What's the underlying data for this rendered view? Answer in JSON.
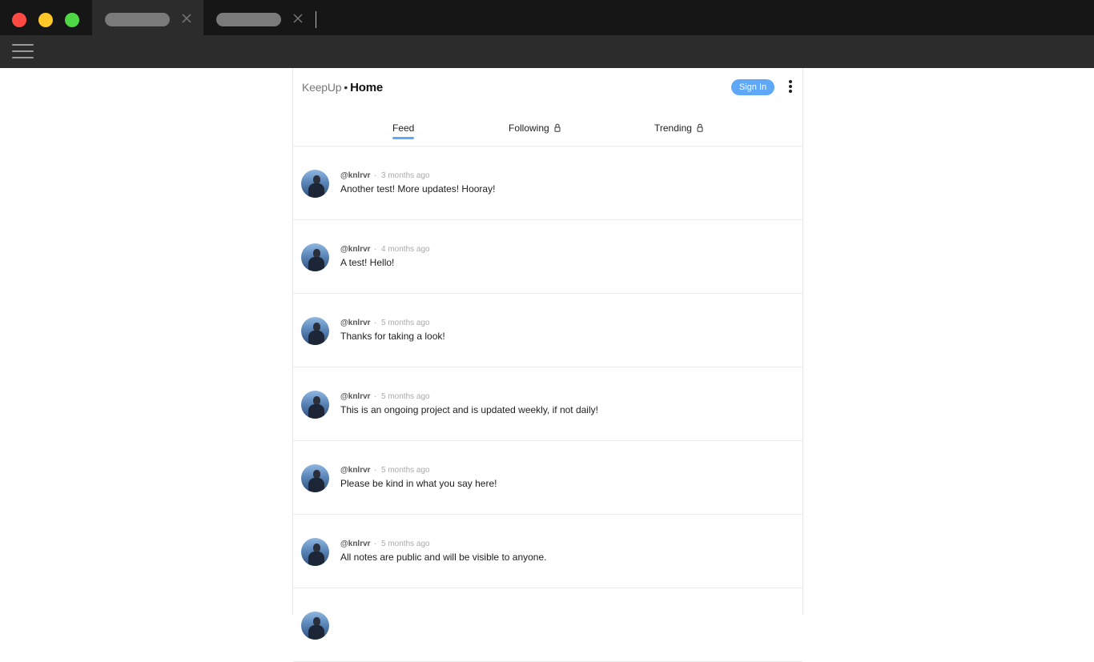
{
  "window": {
    "controls": [
      "close",
      "minimize",
      "maximize"
    ],
    "tabs": [
      {
        "state": "active"
      },
      {
        "state": "inactive"
      }
    ]
  },
  "header": {
    "brand": "KeepUp",
    "separator": "•",
    "page_title": "Home",
    "sign_in_label": "Sign In",
    "more_icon": "vertical-dots-icon"
  },
  "nav": {
    "tabs": [
      {
        "label": "Feed",
        "active": true,
        "locked": false
      },
      {
        "label": "Following",
        "active": false,
        "locked": true
      },
      {
        "label": "Trending",
        "active": false,
        "locked": true
      }
    ]
  },
  "feed": {
    "separator": "·",
    "posts": [
      {
        "user": "@knlrvr",
        "time": "3 months ago",
        "text": "Another test! More updates! Hooray!"
      },
      {
        "user": "@knlrvr",
        "time": "4 months ago",
        "text": "A test! Hello!"
      },
      {
        "user": "@knlrvr",
        "time": "5 months ago",
        "text": "Thanks for taking a look!"
      },
      {
        "user": "@knlrvr",
        "time": "5 months ago",
        "text": "This is an ongoing project and is updated weekly, if not daily!"
      },
      {
        "user": "@knlrvr",
        "time": "5 months ago",
        "text": "Please be kind in what you say here!"
      },
      {
        "user": "@knlrvr",
        "time": "5 months ago",
        "text": "All notes are public and will be visible to anyone."
      }
    ]
  },
  "colors": {
    "accent": "#5fa8f7",
    "chrome_dark": "#161616",
    "toolbar": "#2c2c2c"
  }
}
